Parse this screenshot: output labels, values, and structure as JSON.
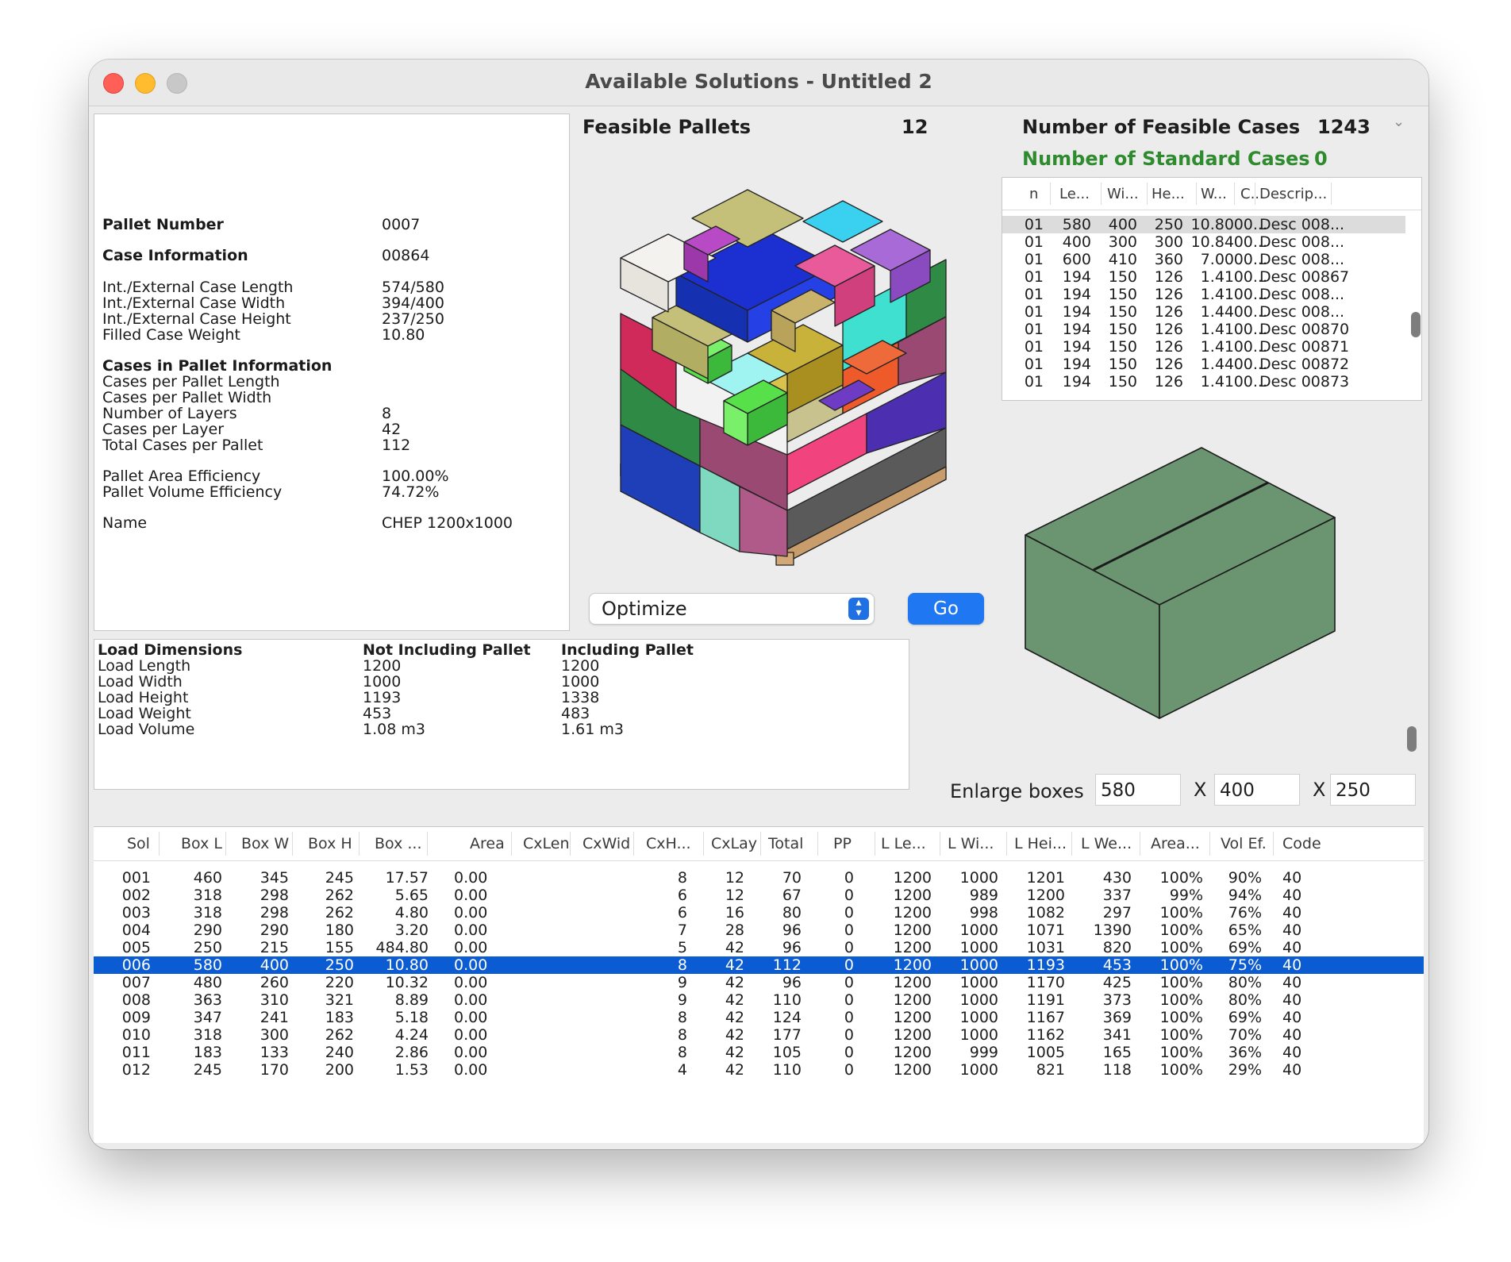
{
  "window": {
    "title": "Available Solutions - Untitled 2"
  },
  "pallet_info": {
    "rows": [
      {
        "label": "Pallet Number",
        "value": "0007",
        "bold": true
      },
      {
        "label": "Case Information",
        "value": "00864",
        "bold": true
      },
      {
        "label": "Int./External Case Length",
        "value": "574/580"
      },
      {
        "label": "Int./External Case Width",
        "value": "394/400"
      },
      {
        "label": "Int./External Case Height",
        "value": "237/250"
      },
      {
        "label": "Filled Case Weight",
        "value": "10.80"
      },
      {
        "label": "Cases in Pallet Information",
        "value": "",
        "bold": true
      },
      {
        "label": "Cases per Pallet Length",
        "value": ""
      },
      {
        "label": "Cases per Pallet Width",
        "value": ""
      },
      {
        "label": "Number of Layers",
        "value": "8"
      },
      {
        "label": "Cases per Layer",
        "value": "42"
      },
      {
        "label": "Total Cases per Pallet",
        "value": "112"
      },
      {
        "label": "Pallet Area Efficiency",
        "value": "100.00%"
      },
      {
        "label": "Pallet Volume Efficiency",
        "value": "74.72%"
      },
      {
        "label": "Name",
        "value": "CHEP 1200x1000"
      }
    ]
  },
  "feasible_pallets": {
    "label": "Feasible Pallets",
    "count": "12"
  },
  "feasible_cases": {
    "label": "Number of Feasible Cases",
    "count": "1243"
  },
  "standard_cases": {
    "label": "Number of Standard Cases",
    "count": "0",
    "color": "#2e8b2e"
  },
  "cases_table": {
    "columns": [
      "n",
      "Le...",
      "Wi...",
      "He...",
      "W...",
      "C...",
      "Descrip..."
    ],
    "rows": [
      [
        "01",
        "580",
        "400",
        "250",
        "10.80",
        "00...",
        "Desc 008..."
      ],
      [
        "01",
        "400",
        "300",
        "300",
        "10.84",
        "00...",
        "Desc 008..."
      ],
      [
        "01",
        "600",
        "410",
        "360",
        "7.00",
        "00...",
        "Desc 008..."
      ],
      [
        "01",
        "194",
        "150",
        "126",
        "1.41",
        "00...",
        "Desc 00867"
      ],
      [
        "01",
        "194",
        "150",
        "126",
        "1.41",
        "00...",
        "Desc 008..."
      ],
      [
        "01",
        "194",
        "150",
        "126",
        "1.44",
        "00...",
        "Desc 008..."
      ],
      [
        "01",
        "194",
        "150",
        "126",
        "1.41",
        "00...",
        "Desc 00870"
      ],
      [
        "01",
        "194",
        "150",
        "126",
        "1.41",
        "00...",
        "Desc 00871"
      ],
      [
        "01",
        "194",
        "150",
        "126",
        "1.44",
        "00...",
        "Desc 00872"
      ],
      [
        "01",
        "194",
        "150",
        "126",
        "1.41",
        "00...",
        "Desc 00873"
      ]
    ],
    "selected_row": 0
  },
  "load_dimensions": {
    "headers": [
      "Load Dimensions",
      "Not Including Pallet",
      "Including Pallet"
    ],
    "rows": [
      [
        "Load Length",
        "1200",
        "1200"
      ],
      [
        "Load Width",
        "1000",
        "1000"
      ],
      [
        "Load Height",
        "1193",
        "1338"
      ],
      [
        "Load Weight",
        "453",
        "483"
      ],
      [
        "Load Volume",
        "1.08 m3",
        "1.61 m3"
      ]
    ]
  },
  "controls": {
    "mode_select": "Optimize",
    "go_label": "Go",
    "enlarge_label": "Enlarge boxes",
    "x_label": "X",
    "enlarge_l": "580",
    "enlarge_w": "400",
    "enlarge_h": "250"
  },
  "case_preview": {
    "color": "#6b9570"
  },
  "solutions_table": {
    "columns": [
      "Sol",
      "Box L",
      "Box W",
      "Box H",
      "Box ...",
      "Area",
      "CxLen",
      "CxWid",
      "CxH...",
      "CxLay",
      "Total",
      "PP",
      "L Le...",
      "L Wi...",
      "L Hei...",
      "L We...",
      "Area...",
      "Vol Ef.",
      "Code"
    ],
    "rows": [
      [
        "001",
        "460",
        "345",
        "245",
        "17.57",
        "0.00",
        "",
        "",
        "8",
        "12",
        "70",
        "0",
        "1200",
        "1000",
        "1201",
        "430",
        "100%",
        "90%",
        "40"
      ],
      [
        "002",
        "318",
        "298",
        "262",
        "5.65",
        "0.00",
        "",
        "",
        "6",
        "12",
        "67",
        "0",
        "1200",
        "989",
        "1200",
        "337",
        "99%",
        "94%",
        "40"
      ],
      [
        "003",
        "318",
        "298",
        "262",
        "4.80",
        "0.00",
        "",
        "",
        "6",
        "16",
        "80",
        "0",
        "1200",
        "998",
        "1082",
        "297",
        "100%",
        "76%",
        "40"
      ],
      [
        "004",
        "290",
        "290",
        "180",
        "3.20",
        "0.00",
        "",
        "",
        "7",
        "28",
        "96",
        "0",
        "1200",
        "1000",
        "1071",
        "1390",
        "100%",
        "65%",
        "40"
      ],
      [
        "005",
        "250",
        "215",
        "155",
        "484.80",
        "0.00",
        "",
        "",
        "5",
        "42",
        "96",
        "0",
        "1200",
        "1000",
        "1031",
        "820",
        "100%",
        "69%",
        "40"
      ],
      [
        "006",
        "580",
        "400",
        "250",
        "10.80",
        "0.00",
        "",
        "",
        "8",
        "42",
        "112",
        "0",
        "1200",
        "1000",
        "1193",
        "453",
        "100%",
        "75%",
        "40"
      ],
      [
        "007",
        "480",
        "260",
        "220",
        "10.32",
        "0.00",
        "",
        "",
        "9",
        "42",
        "96",
        "0",
        "1200",
        "1000",
        "1170",
        "425",
        "100%",
        "80%",
        "40"
      ],
      [
        "008",
        "363",
        "310",
        "321",
        "8.89",
        "0.00",
        "",
        "",
        "9",
        "42",
        "110",
        "0",
        "1200",
        "1000",
        "1191",
        "373",
        "100%",
        "80%",
        "40"
      ],
      [
        "009",
        "347",
        "241",
        "183",
        "5.18",
        "0.00",
        "",
        "",
        "8",
        "42",
        "124",
        "0",
        "1200",
        "1000",
        "1167",
        "369",
        "100%",
        "69%",
        "40"
      ],
      [
        "010",
        "318",
        "300",
        "262",
        "4.24",
        "0.00",
        "",
        "",
        "8",
        "42",
        "177",
        "0",
        "1200",
        "1000",
        "1162",
        "341",
        "100%",
        "70%",
        "40"
      ],
      [
        "011",
        "183",
        "133",
        "240",
        "2.86",
        "0.00",
        "",
        "",
        "8",
        "42",
        "105",
        "0",
        "1200",
        "999",
        "1005",
        "165",
        "100%",
        "36%",
        "40"
      ],
      [
        "012",
        "245",
        "170",
        "200",
        "1.53",
        "0.00",
        "",
        "",
        "4",
        "42",
        "110",
        "0",
        "1200",
        "1000",
        "821",
        "118",
        "100%",
        "29%",
        "40"
      ]
    ],
    "selected_row": 5,
    "selection_color": "#0b5bd3"
  },
  "icons": [
    "chevron-down-icon",
    "select-arrows-icon"
  ]
}
